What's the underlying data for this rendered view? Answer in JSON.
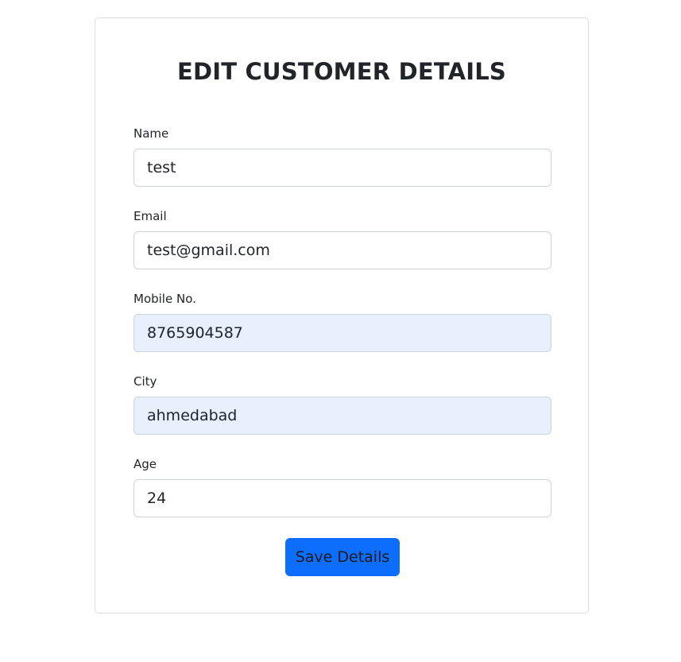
{
  "form": {
    "title": "EDIT CUSTOMER DETAILS",
    "fields": [
      {
        "label": "Name",
        "value": "test"
      },
      {
        "label": "Email",
        "value": "test@gmail.com"
      },
      {
        "label": "Mobile No.",
        "value": "8765904587"
      },
      {
        "label": "City",
        "value": "ahmedabad"
      },
      {
        "label": "Age",
        "value": "24"
      }
    ],
    "submit_label": "Save Details"
  },
  "colors": {
    "primary_button": "#0d6efd",
    "autofill_background": "#e8f0fe",
    "input_border": "#ced4da"
  }
}
